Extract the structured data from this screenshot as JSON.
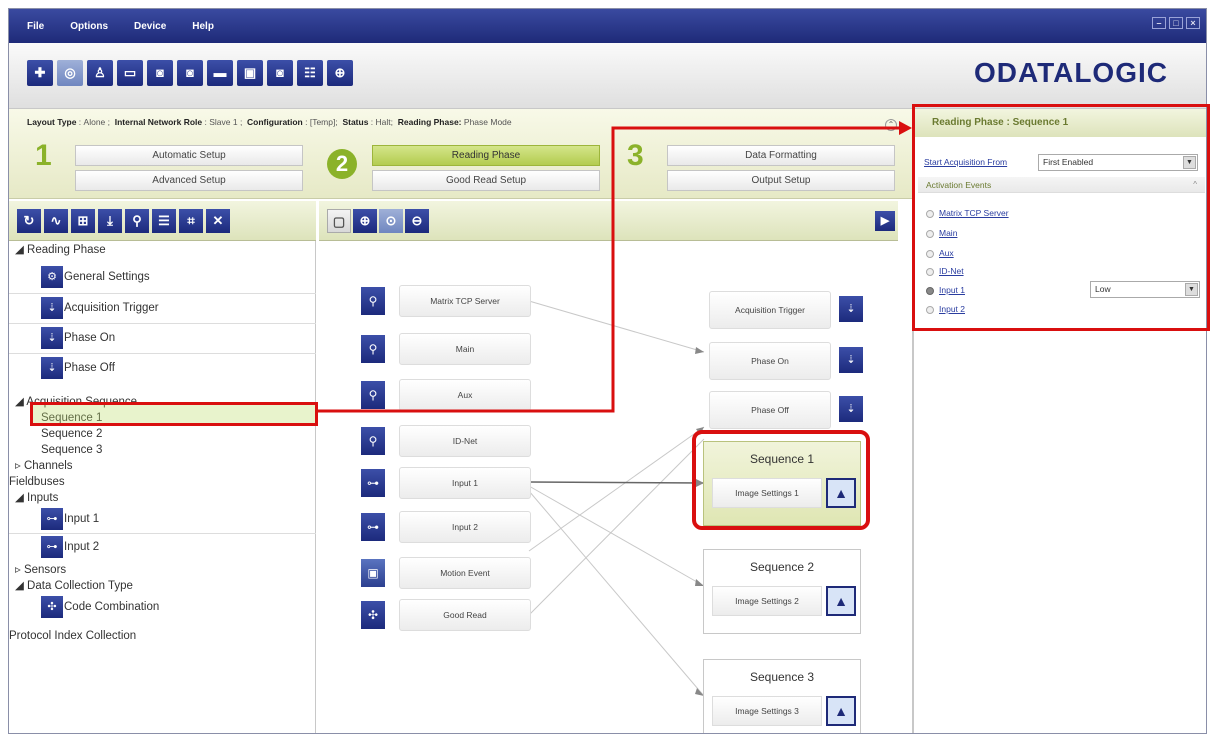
{
  "menu": [
    "File",
    "Options",
    "Device",
    "Help"
  ],
  "window_controls": [
    "–",
    "□",
    "×"
  ],
  "logo": "ODATALOGIC",
  "toolbar_icons": [
    "connect-icon",
    "disconnect-icon",
    "user-icon",
    "monitor-icon",
    "camera-icon",
    "camera-settings-icon",
    "image-icon",
    "save-icon",
    "device-icon",
    "statistics-icon",
    "target-icon"
  ],
  "layout_info": {
    "layout_type_label": "Layout Type",
    "layout_type_value": "Alone",
    "network_role_label": "Internal Network Role",
    "network_role_value": "Slave 1",
    "configuration_label": "Configuration",
    "configuration_value": "[Temp]",
    "status_label": "Status",
    "status_value": "Halt",
    "reading_phase_label": "Reading Phase:",
    "reading_phase_value": "Phase Mode"
  },
  "steps": {
    "one": "1",
    "two": "2",
    "three": "3",
    "automatic_setup": "Automatic Setup",
    "advanced_setup": "Advanced Setup",
    "reading_phase": "Reading Phase",
    "good_read_setup": "Good Read Setup",
    "data_formatting": "Data Formatting",
    "output_setup": "Output Setup"
  },
  "tree": {
    "reading_phase": "Reading Phase",
    "general_settings": "General Settings",
    "acquisition_trigger": "Acquisition Trigger",
    "phase_on": "Phase On",
    "phase_off": "Phase Off",
    "acquisition_sequence": "Acquisition Sequence",
    "sequence_1": "Sequence 1",
    "sequence_2": "Sequence 2",
    "sequence_3": "Sequence 3",
    "channels": "Channels",
    "fieldbuses": "Fieldbuses",
    "inputs": "Inputs",
    "input_1": "Input 1",
    "input_2": "Input 2",
    "sensors": "Sensors",
    "data_collection_type": "Data Collection Type",
    "code_combination": "Code Combination",
    "protocol_index_collection": "Protocol Index Collection"
  },
  "canvas": {
    "sources": [
      "Matrix TCP Server",
      "Main",
      "Aux",
      "ID-Net",
      "Input 1",
      "Input 2",
      "Motion Event",
      "Good Read"
    ],
    "events": [
      "Acquisition Trigger",
      "Phase On",
      "Phase Off"
    ],
    "sequences": [
      {
        "title": "Sequence  1",
        "image": "Image Settings  1"
      },
      {
        "title": "Sequence  2",
        "image": "Image Settings  2"
      },
      {
        "title": "Sequence  3",
        "image": "Image Settings  3"
      }
    ]
  },
  "right_panel": {
    "title": "Reading Phase :  Sequence 1",
    "start_acquisition_label": "Start Acquisition From",
    "start_acquisition_value": "First Enabled",
    "activation_events_title": "Activation Events",
    "events": [
      "Matrix TCP Server",
      "Main",
      "Aux",
      "ID-Net",
      "Input 1",
      "Input 2"
    ],
    "selected_event": "Input 1",
    "input1_level": "Low"
  },
  "colors": {
    "brand_blue": "#1e2a78",
    "accent_green": "#8bb22a",
    "highlight_red": "#d90f0f"
  }
}
